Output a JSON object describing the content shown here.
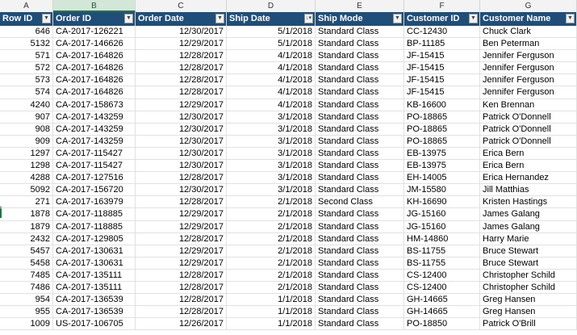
{
  "columns": [
    "A",
    "B",
    "C",
    "D",
    "E",
    "F",
    "G"
  ],
  "headers": [
    "Row ID",
    "Order ID",
    "Order Date",
    "Ship Date",
    "Ship Mode",
    "Customer ID",
    "Customer Name"
  ],
  "rows": [
    [
      "646",
      "CA-2017-126221",
      "12/30/2017",
      "5/1/2018",
      "Standard Class",
      "CC-12430",
      "Chuck Clark"
    ],
    [
      "5132",
      "CA-2017-146626",
      "12/29/2017",
      "5/1/2018",
      "Standard Class",
      "BP-11185",
      "Ben Peterman"
    ],
    [
      "571",
      "CA-2017-164826",
      "12/28/2017",
      "4/1/2018",
      "Standard Class",
      "JF-15415",
      "Jennifer Ferguson"
    ],
    [
      "572",
      "CA-2017-164826",
      "12/28/2017",
      "4/1/2018",
      "Standard Class",
      "JF-15415",
      "Jennifer Ferguson"
    ],
    [
      "573",
      "CA-2017-164826",
      "12/28/2017",
      "4/1/2018",
      "Standard Class",
      "JF-15415",
      "Jennifer Ferguson"
    ],
    [
      "574",
      "CA-2017-164826",
      "12/28/2017",
      "4/1/2018",
      "Standard Class",
      "JF-15415",
      "Jennifer Ferguson"
    ],
    [
      "4240",
      "CA-2017-158673",
      "12/29/2017",
      "4/1/2018",
      "Standard Class",
      "KB-16600",
      "Ken Brennan"
    ],
    [
      "907",
      "CA-2017-143259",
      "12/30/2017",
      "3/1/2018",
      "Standard Class",
      "PO-18865",
      "Patrick O'Donnell"
    ],
    [
      "908",
      "CA-2017-143259",
      "12/30/2017",
      "3/1/2018",
      "Standard Class",
      "PO-18865",
      "Patrick O'Donnell"
    ],
    [
      "909",
      "CA-2017-143259",
      "12/30/2017",
      "3/1/2018",
      "Standard Class",
      "PO-18865",
      "Patrick O'Donnell"
    ],
    [
      "1297",
      "CA-2017-115427",
      "12/30/2017",
      "3/1/2018",
      "Standard Class",
      "EB-13975",
      "Erica Bern"
    ],
    [
      "1298",
      "CA-2017-115427",
      "12/30/2017",
      "3/1/2018",
      "Standard Class",
      "EB-13975",
      "Erica Bern"
    ],
    [
      "4288",
      "CA-2017-127516",
      "12/28/2017",
      "3/1/2018",
      "Standard Class",
      "EH-14005",
      "Erica Hernandez"
    ],
    [
      "5092",
      "CA-2017-156720",
      "12/30/2017",
      "3/1/2018",
      "Standard Class",
      "JM-15580",
      "Jill Matthias"
    ],
    [
      "271",
      "CA-2017-163979",
      "12/28/2017",
      "2/1/2018",
      "Second Class",
      "KH-16690",
      "Kristen Hastings"
    ],
    [
      "1878",
      "CA-2017-118885",
      "12/29/2017",
      "2/1/2018",
      "Standard Class",
      "JG-15160",
      "James Galang"
    ],
    [
      "1879",
      "CA-2017-118885",
      "12/29/2017",
      "2/1/2018",
      "Standard Class",
      "JG-15160",
      "James Galang"
    ],
    [
      "2432",
      "CA-2017-129805",
      "12/28/2017",
      "2/1/2018",
      "Standard Class",
      "HM-14860",
      "Harry Marie"
    ],
    [
      "5457",
      "CA-2017-130631",
      "12/29/2017",
      "2/1/2018",
      "Standard Class",
      "BS-11755",
      "Bruce Stewart"
    ],
    [
      "5458",
      "CA-2017-130631",
      "12/29/2017",
      "2/1/2018",
      "Standard Class",
      "BS-11755",
      "Bruce Stewart"
    ],
    [
      "7485",
      "CA-2017-135111",
      "12/28/2017",
      "2/1/2018",
      "Standard Class",
      "CS-12400",
      "Christopher Schild"
    ],
    [
      "7486",
      "CA-2017-135111",
      "12/28/2017",
      "2/1/2018",
      "Standard Class",
      "CS-12400",
      "Christopher Schild"
    ],
    [
      "954",
      "CA-2017-136539",
      "12/28/2017",
      "1/1/2018",
      "Standard Class",
      "GH-14665",
      "Greg Hansen"
    ],
    [
      "955",
      "CA-2017-136539",
      "12/28/2017",
      "1/1/2018",
      "Standard Class",
      "GH-14665",
      "Greg Hansen"
    ],
    [
      "1009",
      "US-2017-106705",
      "12/26/2017",
      "1/1/2018",
      "Standard Class",
      "PO-18850",
      "Patrick O'Brill"
    ]
  ],
  "colors": {
    "header_bg": "#1f4e79",
    "selected_col": "#d2e7d8",
    "accent": "#217346"
  },
  "icons": {
    "filter": "filter-dropdown-icon",
    "sorted_filter": "sorted-filter-icon"
  }
}
